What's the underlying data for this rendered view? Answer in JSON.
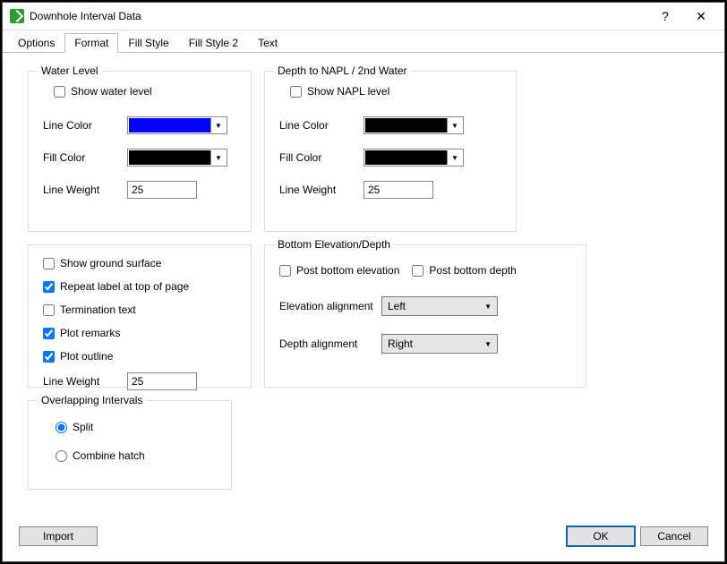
{
  "window": {
    "title": "Downhole Interval Data",
    "help": "?",
    "close": "✕"
  },
  "tabs": [
    "Options",
    "Format",
    "Fill Style",
    "Fill Style 2",
    "Text"
  ],
  "activeTabIndex": 1,
  "groups": {
    "waterLevel": {
      "legend": "Water Level",
      "showLabel": "Show water level",
      "lineColorLabel": "Line Color",
      "lineColor": "#0000ff",
      "fillColorLabel": "Fill Color",
      "fillColor": "#000000",
      "lineWeightLabel": "Line Weight",
      "lineWeight": "25"
    },
    "napl": {
      "legend": "Depth to NAPL / 2nd Water",
      "showLabel": "Show NAPL level",
      "lineColorLabel": "Line Color",
      "lineColor": "#000000",
      "fillColorLabel": "Fill Color",
      "fillColor": "#000000",
      "lineWeightLabel": "Line Weight",
      "lineWeight": "25"
    },
    "misc": {
      "showGround": "Show ground surface",
      "repeatLabel": "Repeat label at top of page",
      "termination": "Termination text",
      "plotRemarks": "Plot remarks",
      "plotOutline": "Plot outline",
      "lineWeightLabel": "Line Weight",
      "lineWeight": "25"
    },
    "bottom": {
      "legend": "Bottom Elevation/Depth",
      "postElev": "Post bottom elevation",
      "postDepth": "Post bottom depth",
      "elevAlignLabel": "Elevation alignment",
      "elevAlign": "Left",
      "depthAlignLabel": "Depth alignment",
      "depthAlign": "Right"
    },
    "overlap": {
      "legend": "Overlapping Intervals",
      "split": "Split",
      "combine": "Combine hatch"
    }
  },
  "buttons": {
    "import": "Import",
    "ok": "OK",
    "cancel": "Cancel"
  }
}
